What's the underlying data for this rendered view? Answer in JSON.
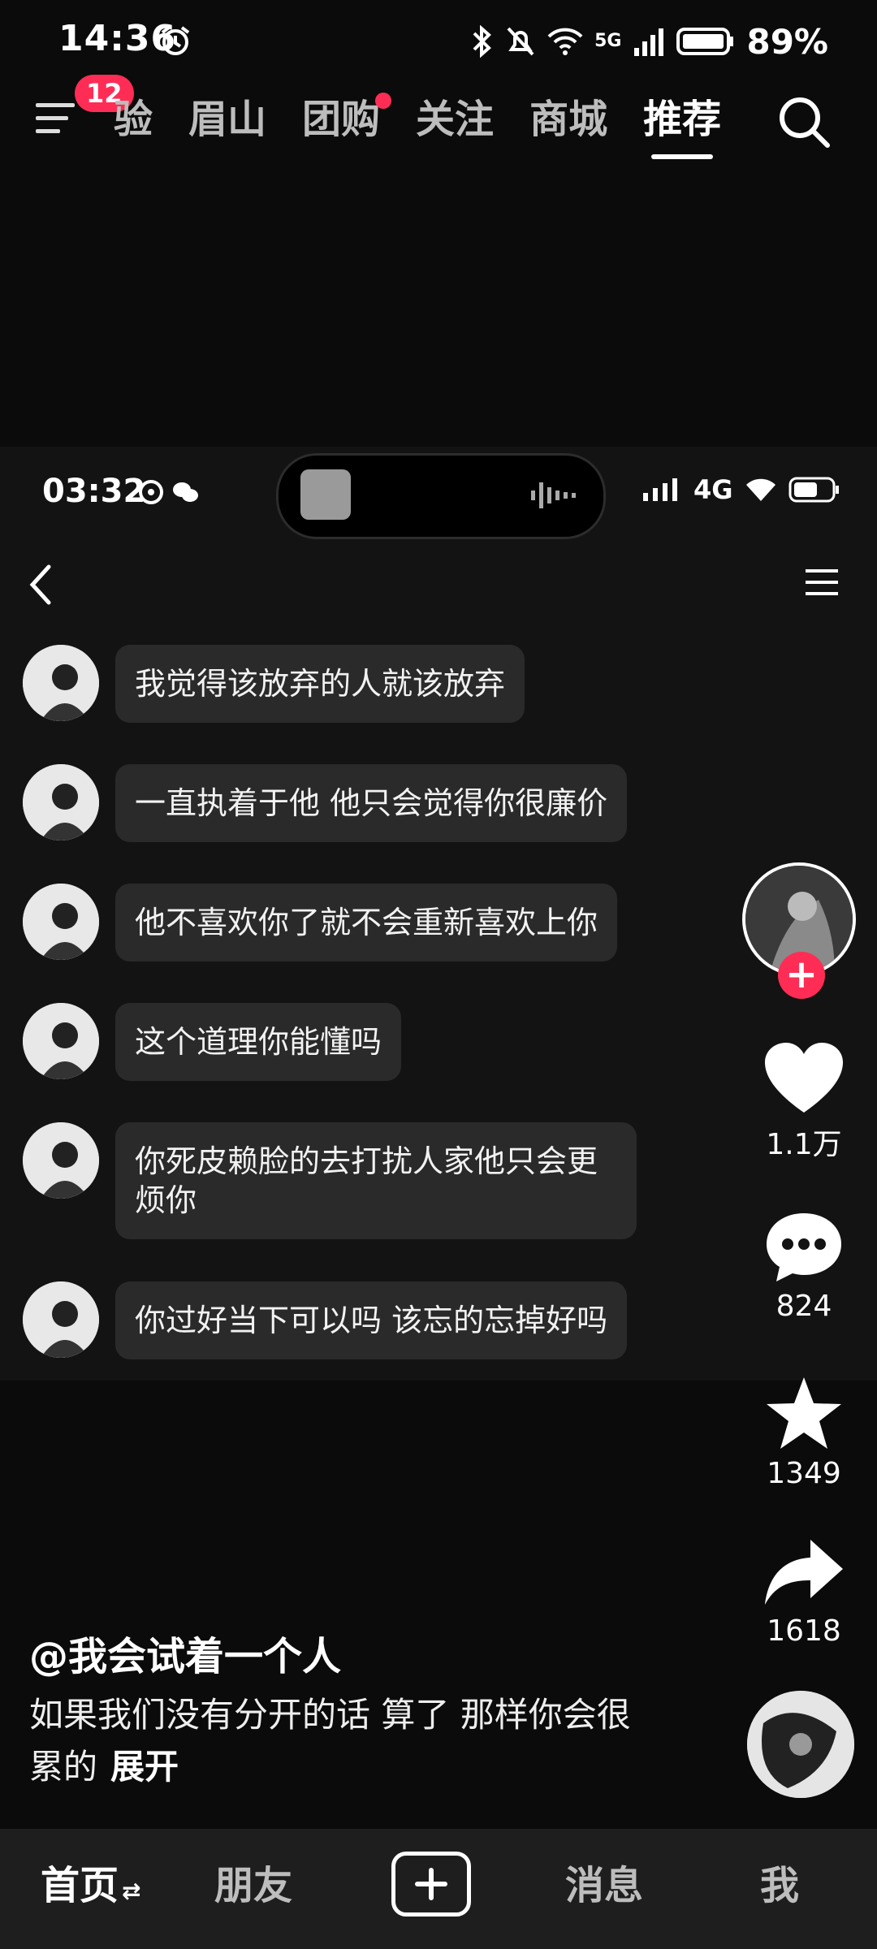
{
  "status_bar": {
    "time": "14:36",
    "network": "5G",
    "battery": "89%"
  },
  "top_nav": {
    "badge": "12",
    "tabs": [
      {
        "label": "验"
      },
      {
        "label": "眉山"
      },
      {
        "label": "团购"
      },
      {
        "label": "关注"
      },
      {
        "label": "商城"
      },
      {
        "label": "推荐"
      }
    ],
    "active_tab": "推荐"
  },
  "video": {
    "inner_status": {
      "time": "03:32",
      "network": "4G"
    },
    "messages": [
      {
        "text": "我觉得该放弃的人就该放弃"
      },
      {
        "text": "一直执着于他 他只会觉得你很廉价"
      },
      {
        "text": "他不喜欢你了就不会重新喜欢上你"
      },
      {
        "text": "这个道理你能懂吗"
      },
      {
        "text": "你死皮赖脸的去打扰人家他只会更烦你"
      },
      {
        "text": "你过好当下可以吗 该忘的忘掉好吗"
      }
    ]
  },
  "actions": {
    "likes": "1.1万",
    "comments": "824",
    "favorites": "1349",
    "shares": "1618"
  },
  "caption": {
    "author": "@我会试着一个人",
    "text": "如果我们没有分开的话  算了  那样你会很累的",
    "expand": "展开"
  },
  "bottom_nav": {
    "home": "首页",
    "friends": "朋友",
    "messages": "消息",
    "me": "我"
  },
  "colors": {
    "accent": "#ff2d55",
    "bubble": "#2a2a2a"
  }
}
